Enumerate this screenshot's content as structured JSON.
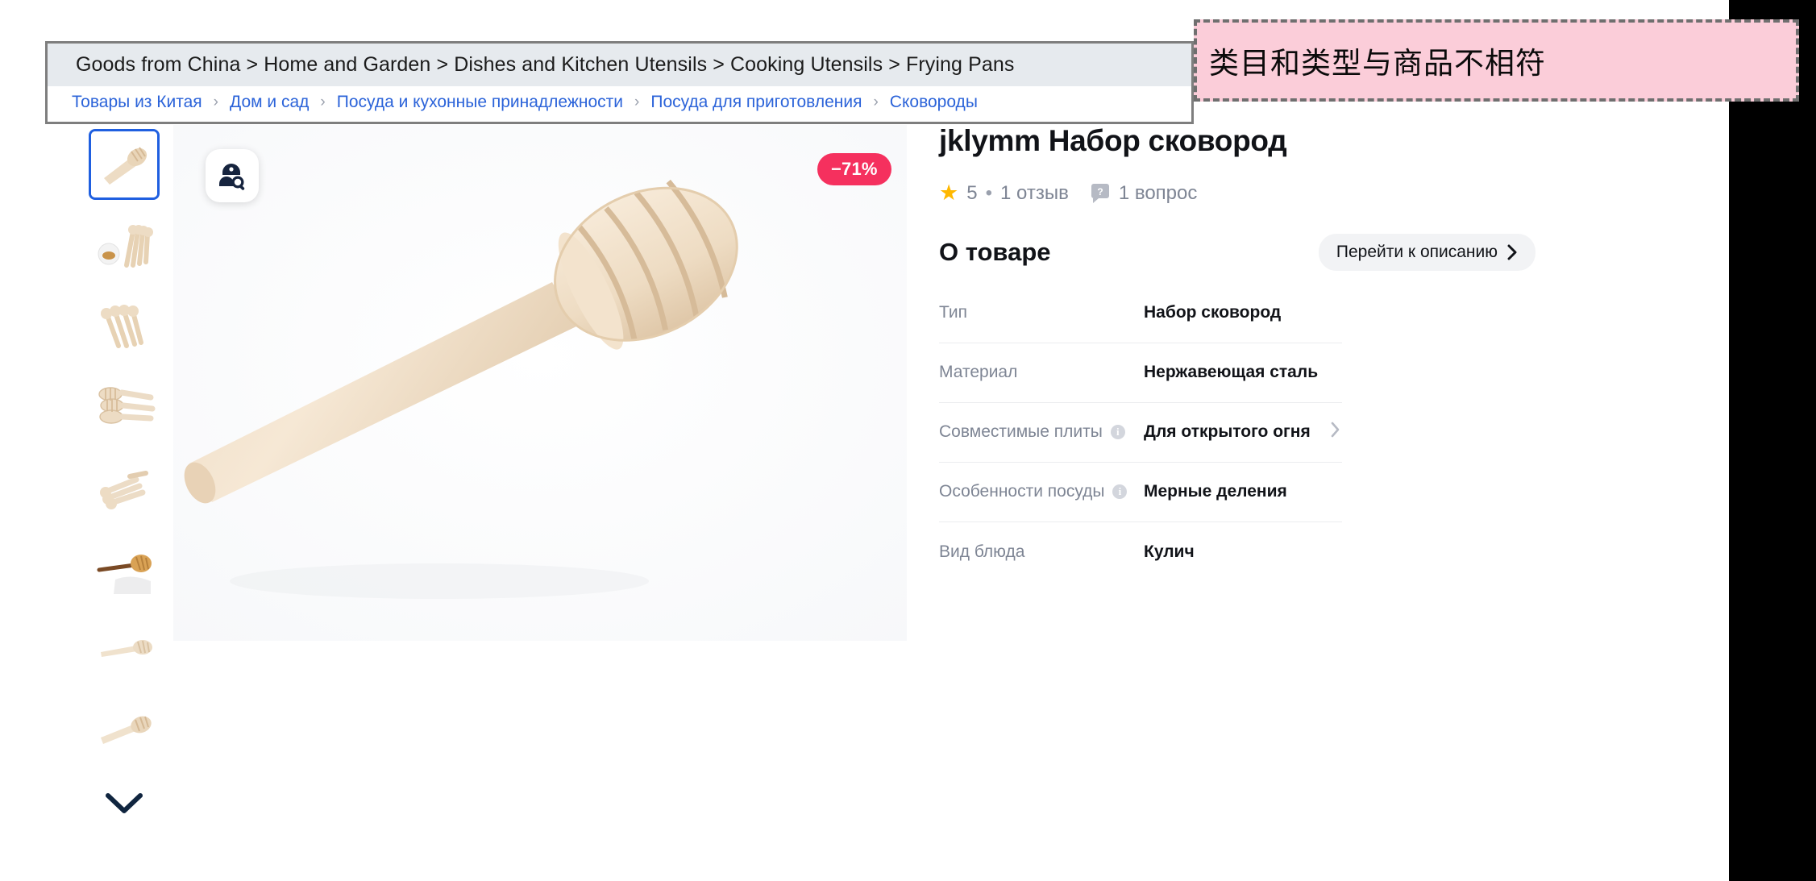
{
  "annotation": {
    "text": "类目和类型与商品不相符",
    "background_color": "#fbcdd9",
    "border_color": "#6f6f6f"
  },
  "breadcrumb": {
    "english": "Goods from China > Home and Garden > Dishes and Kitchen Utensils > Cooking Utensils > Frying Pans",
    "russian_items": [
      "Товары из Китая",
      "Дом и сад",
      "Посуда и кухонные принадлежности",
      "Посуда для приготовления",
      "Сковороды"
    ],
    "separator": "›",
    "link_color": "#2b63d9"
  },
  "gallery": {
    "lens_icon": "image-search-icon",
    "discount_badge": "−71%",
    "discount_color": "#f5305e",
    "selected_thumb_index": 0,
    "selected_border_color": "#1f5fe0",
    "more_chevron_icon": "chevron-down-icon",
    "thumbnails": [
      {
        "alt": "single-honey-dipper",
        "variant": 0
      },
      {
        "alt": "dippers-with-honey-bowl",
        "variant": 1
      },
      {
        "alt": "fan-of-dippers",
        "variant": 2
      },
      {
        "alt": "stacked-dipper-heads",
        "variant": 3
      },
      {
        "alt": "group-of-dippers",
        "variant": 4
      },
      {
        "alt": "dipper-in-honey-jar",
        "variant": 5
      },
      {
        "alt": "dipper-side-view",
        "variant": 6
      },
      {
        "alt": "dipper-angled-view",
        "variant": 7
      }
    ]
  },
  "product": {
    "title": "jklymm Набор сковород",
    "rating_value": "5",
    "rating_separator": "•",
    "reviews_label": "1 отзыв",
    "questions_label": "1 вопрос",
    "star_color": "#ffb800",
    "star_icon": "star-icon",
    "question_icon": "question-bubble-icon"
  },
  "about": {
    "heading": "О товаре",
    "description_link_label": "Перейти к описанию",
    "description_link_icon": "chevron-right-icon",
    "attributes": [
      {
        "key": "Тип",
        "value": "Набор сковород",
        "info": false,
        "chevron": false
      },
      {
        "key": "Материал",
        "value": "Нержавеющая сталь",
        "info": false,
        "chevron": false
      },
      {
        "key": "Совместимые плиты",
        "value": "Для открытого огня",
        "info": true,
        "chevron": true
      },
      {
        "key": "Особенности посуды",
        "value": "Мерные деления",
        "info": true,
        "chevron": false
      },
      {
        "key": "Вид блюда",
        "value": "Кулич",
        "info": false,
        "chevron": false
      }
    ],
    "info_icon": "info-icon"
  }
}
